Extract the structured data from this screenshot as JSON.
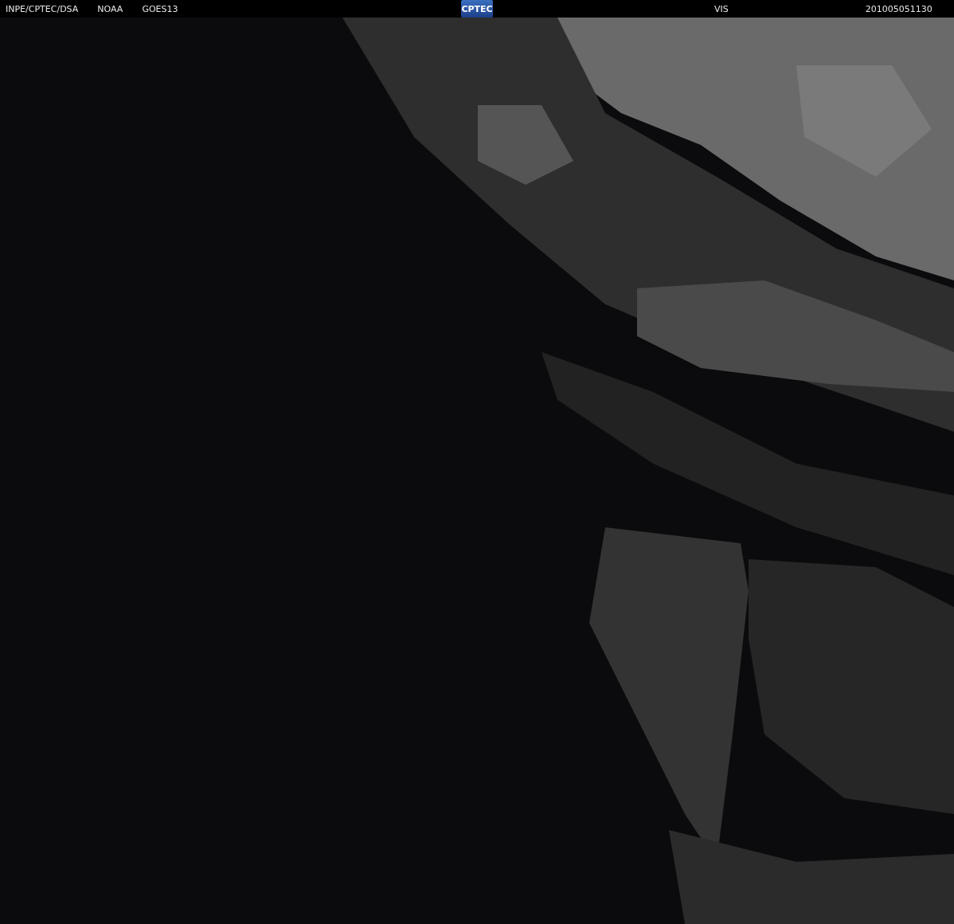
{
  "header": {
    "left_labels": [
      "INPE/CPTEC/DSA",
      "NOAA",
      "GOES13"
    ],
    "logo": "CPTEC",
    "channel": "VIS",
    "timestamp": "201005051130"
  }
}
